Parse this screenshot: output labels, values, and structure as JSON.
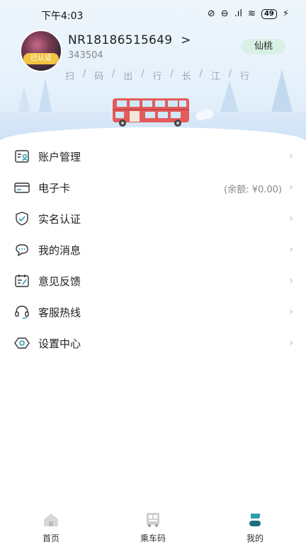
{
  "status_bar": {
    "time": "下午4:03",
    "battery": "49"
  },
  "profile": {
    "username": "NR18186515649",
    "chevron": ">",
    "user_id": "343504",
    "verified_badge": "已认证",
    "city": "仙桃"
  },
  "slogan": [
    "扫",
    "码",
    "出",
    "行",
    "长",
    "江",
    "行"
  ],
  "menu": [
    {
      "label": "账户管理",
      "icon": "account-manage-icon"
    },
    {
      "label": "电子卡",
      "icon": "card-icon",
      "value": "(余额: ¥0.00)"
    },
    {
      "label": "实名认证",
      "icon": "shield-check-icon"
    },
    {
      "label": "我的消息",
      "icon": "message-bubble-icon"
    },
    {
      "label": "意见反馈",
      "icon": "feedback-icon"
    },
    {
      "label": "客服热线",
      "icon": "headset-icon"
    },
    {
      "label": "设置中心",
      "icon": "settings-hex-icon"
    }
  ],
  "tabbar": [
    {
      "label": "首页",
      "icon": "home-icon"
    },
    {
      "label": "乘车码",
      "icon": "bus-code-icon"
    },
    {
      "label": "我的",
      "icon": "profile-icon",
      "active": true
    }
  ],
  "colors": {
    "accent": "#2a9fb0",
    "city_pill": "#d9f0e4",
    "badge": "#f3c443",
    "bus": "#e45b5b"
  }
}
